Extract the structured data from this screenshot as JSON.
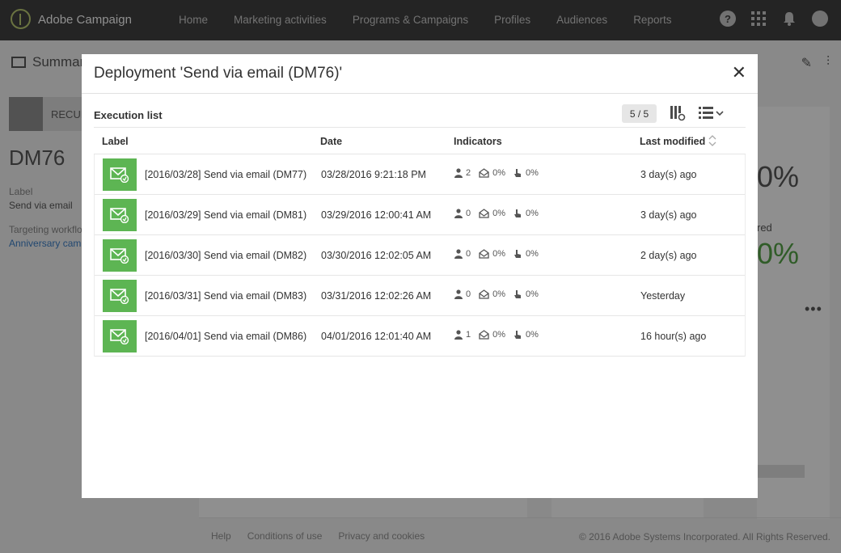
{
  "app": {
    "brand": "Adobe Campaign",
    "nav": [
      "Home",
      "Marketing activities",
      "Programs & Campaigns",
      "Profiles",
      "Audiences",
      "Reports"
    ],
    "help_symbol": "?"
  },
  "background": {
    "summary_label": "Summar",
    "recur_label": "RECUR",
    "delivery_code": "DM76",
    "label_caption": "Label",
    "label_value": "Send via email",
    "targeting_caption": "Targeting workflo",
    "targeting_link": "Anniversary cam",
    "metric1": "0%",
    "metric2_caption": "red",
    "metric2": "0%",
    "footer": [
      "Help",
      "Conditions of use",
      "Privacy and cookies"
    ],
    "copyright": "© 2016 Adobe Systems Incorporated. All Rights Reserved."
  },
  "modal": {
    "title": "Deployment 'Send via email (DM76)'",
    "section_title": "Execution list",
    "counter": "5 / 5",
    "columns": {
      "label": "Label",
      "date": "Date",
      "indicators": "Indicators",
      "last_modified": "Last modified"
    },
    "rows": [
      {
        "label": "[2016/03/28] Send via email (DM77)",
        "date": "03/28/2016 9:21:18 PM",
        "targets": "2",
        "opens": "0%",
        "clicks": "0%",
        "modified": "3 day(s) ago"
      },
      {
        "label": "[2016/03/29] Send via email (DM81)",
        "date": "03/29/2016 12:00:41 AM",
        "targets": "0",
        "opens": "0%",
        "clicks": "0%",
        "modified": "3 day(s) ago"
      },
      {
        "label": "[2016/03/30] Send via email (DM82)",
        "date": "03/30/2016 12:02:05 AM",
        "targets": "0",
        "opens": "0%",
        "clicks": "0%",
        "modified": "2 day(s) ago"
      },
      {
        "label": "[2016/03/31] Send via email (DM83)",
        "date": "03/31/2016 12:02:26 AM",
        "targets": "0",
        "opens": "0%",
        "clicks": "0%",
        "modified": "Yesterday"
      },
      {
        "label": "[2016/04/01] Send via email (DM86)",
        "date": "04/01/2016 12:01:40 AM",
        "targets": "1",
        "opens": "0%",
        "clicks": "0%",
        "modified": "16 hour(s) ago"
      }
    ]
  },
  "colors": {
    "topbar": "#323232",
    "accent_green": "#5db553",
    "link_blue": "#2d76c4"
  },
  "icons": [
    "adobe-campaign-logo-icon",
    "help-icon",
    "apps-grid-icon",
    "bell-icon",
    "avatar-icon",
    "email-delivery-icon",
    "column-config-icon",
    "list-view-icon",
    "sort-icon",
    "person-icon",
    "open-envelope-icon",
    "click-hand-icon",
    "close-icon"
  ]
}
